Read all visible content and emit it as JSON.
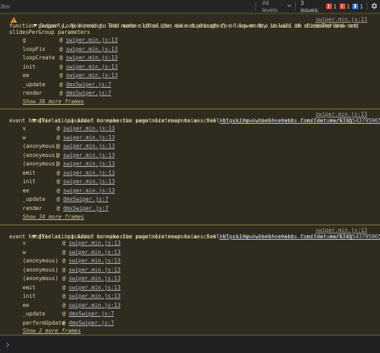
{
  "toolbar": {
    "filter_text": "ilter",
    "levels_label": "All levels",
    "issues_label": "3 issues:",
    "badges": [
      {
        "count": "1",
        "color": "#e64a3b"
      },
      {
        "count": "1",
        "color": "#e64a3b"
      },
      {
        "count": "1",
        "color": "#3f7ed9"
      }
    ]
  },
  "messages": [
    {
      "type": "warning",
      "lines": [
        "Swiper Loop Warning: The number of slides is not enough for loop mode, it will be disabled and not",
        "function properly. You need to add more slides (or make duplicates) or lower the values of slidesPerView and",
        "slidesPerGroup parameters"
      ],
      "source": "swiper.min.js:13",
      "frames": [
        {
          "fn": "g",
          "file": "swiper.min.js:13"
        },
        {
          "fn": "loopFix",
          "file": "swiper.min.js:13"
        },
        {
          "fn": "loopCreate",
          "file": "swiper.min.js:13"
        },
        {
          "fn": "init",
          "file": "swiper.min.js:13"
        },
        {
          "fn": "ee",
          "file": "swiper.min.js:13"
        },
        {
          "fn": "_update",
          "file": "dmxSwiper.js:7"
        },
        {
          "fn": "render",
          "file": "dmxSwiper.js:7"
        }
      ],
      "more": "Show 36 more frames"
    },
    {
      "type": "violation",
      "line1": "[Violation] Added non-passive event listener to a scroll-blocking 'wheel' event. Consider marking",
      "line2": "event handler as 'passive' to make the page more responsive. See ",
      "url": "https://www.chromestatus.com/feature/5745543795965952",
      "source": "swiper.min.js:13",
      "frames": [
        {
          "fn": "v",
          "file": "swiper.min.js:13"
        },
        {
          "fn": "w",
          "file": "swiper.min.js:13"
        },
        {
          "fn": "(anonymous)",
          "file": "swiper.min.js:13"
        },
        {
          "fn": "(anonymous)",
          "file": "swiper.min.js:13"
        },
        {
          "fn": "(anonymous)",
          "file": "swiper.min.js:13"
        },
        {
          "fn": "emit",
          "file": "swiper.min.js:13"
        },
        {
          "fn": "init",
          "file": "swiper.min.js:13"
        },
        {
          "fn": "ee",
          "file": "swiper.min.js:13"
        },
        {
          "fn": "_update",
          "file": "dmxSwiper.js:7"
        },
        {
          "fn": "render",
          "file": "dmxSwiper.js:7"
        }
      ],
      "more": "Show 34 more frames"
    },
    {
      "type": "violation",
      "line1": "[Violation] Added non-passive event listener to a scroll-blocking 'wheel' event. Consider marking",
      "line2": "event handler as 'passive' to make the page more responsive. See ",
      "url": "https://www.chromestatus.com/feature/5745543795965952",
      "source": "swiper.min.js:13",
      "frames": [
        {
          "fn": "v",
          "file": "swiper.min.js:13"
        },
        {
          "fn": "w",
          "file": "swiper.min.js:13"
        },
        {
          "fn": "(anonymous)",
          "file": "swiper.min.js:13"
        },
        {
          "fn": "(anonymous)",
          "file": "swiper.min.js:13"
        },
        {
          "fn": "(anonymous)",
          "file": "swiper.min.js:13"
        },
        {
          "fn": "emit",
          "file": "swiper.min.js:13"
        },
        {
          "fn": "init",
          "file": "swiper.min.js:13"
        },
        {
          "fn": "ee",
          "file": "swiper.min.js:13"
        },
        {
          "fn": "_update",
          "file": "dmxSwiper.js:7"
        },
        {
          "fn": "performUpdate",
          "file": "dmxSwiper.js:7"
        }
      ],
      "more": "Show 2 more frames"
    }
  ]
}
